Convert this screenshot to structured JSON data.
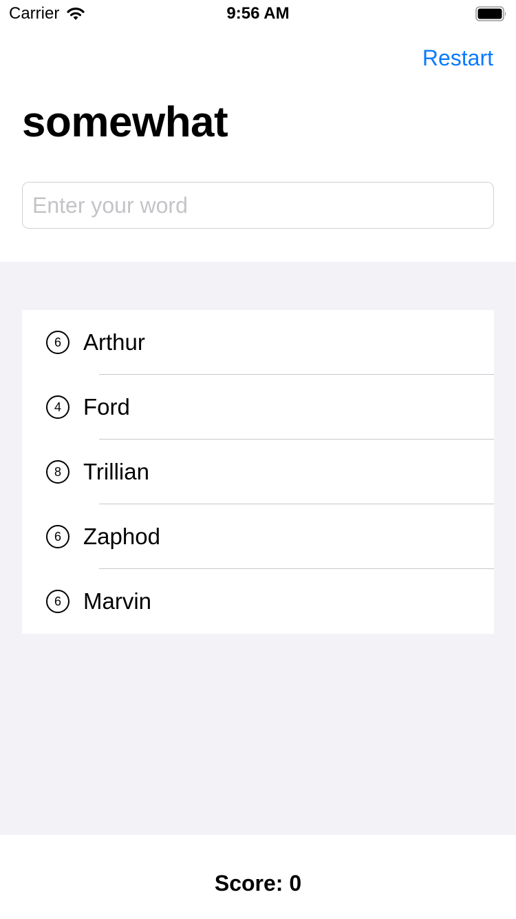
{
  "status_bar": {
    "carrier": "Carrier",
    "time": "9:56 AM"
  },
  "nav": {
    "restart_label": "Restart"
  },
  "title": "somewhat",
  "input": {
    "value": "",
    "placeholder": "Enter your word"
  },
  "words": [
    {
      "count": "6",
      "word": "Arthur"
    },
    {
      "count": "4",
      "word": "Ford"
    },
    {
      "count": "8",
      "word": "Trillian"
    },
    {
      "count": "6",
      "word": "Zaphod"
    },
    {
      "count": "6",
      "word": "Marvin"
    }
  ],
  "score_text": "Score: 0",
  "colors": {
    "accent": "#0a7aff",
    "grouped_background": "#f2f2f7",
    "separator": "#c8c7cc",
    "placeholder": "#c4c4c8"
  },
  "icons": {
    "wifi": "wifi-icon",
    "battery": "battery-icon",
    "count_badge": "circled-number-icon"
  }
}
